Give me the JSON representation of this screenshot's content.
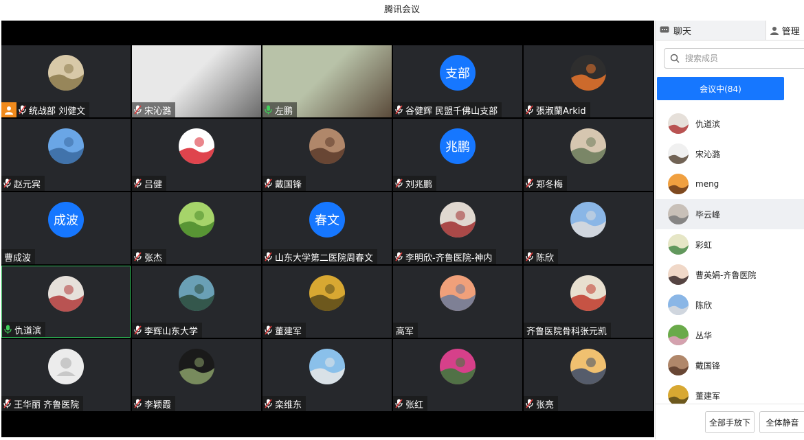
{
  "window": {
    "title": "腾讯会议"
  },
  "tiles": [
    {
      "name": "统战部 刘健文",
      "mic": "muted",
      "host": true,
      "avatar": {
        "kind": "photo",
        "colors": [
          "#d8c9a8",
          "#8c7a4c"
        ]
      }
    },
    {
      "name": "宋沁潞",
      "mic": "muted",
      "avatar": {
        "kind": "camera",
        "colors": [
          "#e8e8e8",
          "#6a6a6a"
        ]
      }
    },
    {
      "name": "左鹏",
      "mic": "on",
      "avatar": {
        "kind": "camera",
        "colors": [
          "#b8c2a8",
          "#5a4a3a"
        ]
      }
    },
    {
      "name": "谷健辉 民盟千佛山支部",
      "mic": "muted",
      "avatar": {
        "kind": "text",
        "text": "支部"
      }
    },
    {
      "name": "張淑蘭Arkid",
      "mic": "muted",
      "avatar": {
        "kind": "photo",
        "colors": [
          "#2e2e2e",
          "#e8742c"
        ]
      }
    },
    {
      "name": "赵元宾",
      "mic": "muted",
      "avatar": {
        "kind": "photo",
        "colors": [
          "#6aa6e6",
          "#3a6aa0"
        ]
      }
    },
    {
      "name": "吕健",
      "mic": "muted",
      "avatar": {
        "kind": "photo",
        "colors": [
          "#ffffff",
          "#d9232e"
        ]
      }
    },
    {
      "name": "戴国锋",
      "mic": "muted",
      "avatar": {
        "kind": "photo",
        "colors": [
          "#b0876a",
          "#5c3b2a"
        ]
      }
    },
    {
      "name": "刘兆鹏",
      "mic": "muted",
      "avatar": {
        "kind": "text",
        "text": "兆鹏"
      }
    },
    {
      "name": "郑冬梅",
      "mic": "muted",
      "avatar": {
        "kind": "photo",
        "colors": [
          "#d6c6b0",
          "#6a7a5a"
        ]
      }
    },
    {
      "name": "曹成波",
      "mic": "none",
      "avatar": {
        "kind": "text",
        "text": "成波"
      }
    },
    {
      "name": "张杰",
      "mic": "muted",
      "avatar": {
        "kind": "photo",
        "colors": [
          "#a6d46a",
          "#4a8a2a"
        ]
      }
    },
    {
      "name": "山东大学第二医院周春文",
      "mic": "muted",
      "avatar": {
        "kind": "text",
        "text": "春文"
      }
    },
    {
      "name": "李明欣-齐鲁医院-神内",
      "mic": "muted",
      "avatar": {
        "kind": "photo",
        "colors": [
          "#e0d8d0",
          "#a03030"
        ]
      }
    },
    {
      "name": "陈欣",
      "mic": "muted",
      "avatar": {
        "kind": "photo",
        "colors": [
          "#8ab6e6",
          "#dcdcdc"
        ]
      }
    },
    {
      "name": "仇道滨",
      "mic": "on",
      "active": true,
      "avatar": {
        "kind": "photo",
        "colors": [
          "#e6e0da",
          "#b03a3a"
        ]
      }
    },
    {
      "name": "李辉山东大学",
      "mic": "muted",
      "avatar": {
        "kind": "photo",
        "colors": [
          "#6aa0b6",
          "#2a4a3a"
        ]
      }
    },
    {
      "name": "董建军",
      "mic": "muted",
      "avatar": {
        "kind": "photo",
        "colors": [
          "#d8a832",
          "#5a4a1a"
        ]
      }
    },
    {
      "name": "高军",
      "mic": "none",
      "avatar": {
        "kind": "photo",
        "colors": [
          "#f0a07a",
          "#6a7a9a"
        ]
      }
    },
    {
      "name": "齐鲁医院骨科张元凯",
      "mic": "none",
      "avatar": {
        "kind": "photo",
        "colors": [
          "#e8e0d0",
          "#c0392b"
        ]
      }
    },
    {
      "name": "王华丽 齐鲁医院",
      "mic": "muted",
      "avatar": {
        "kind": "default"
      }
    },
    {
      "name": "李颖霞",
      "mic": "muted",
      "avatar": {
        "kind": "photo",
        "colors": [
          "#1a1a1a",
          "#8aa06a"
        ]
      }
    },
    {
      "name": "栾维东",
      "mic": "muted",
      "avatar": {
        "kind": "photo",
        "colors": [
          "#8ac0ea",
          "#e6e6e6"
        ]
      }
    },
    {
      "name": "张红",
      "mic": "muted",
      "avatar": {
        "kind": "photo",
        "colors": [
          "#d6408a",
          "#3a7a3a"
        ]
      }
    },
    {
      "name": "张亮",
      "mic": "muted",
      "avatar": {
        "kind": "photo",
        "colors": [
          "#f0c070",
          "#3a4a6a"
        ]
      }
    }
  ],
  "sidebar": {
    "tabs": {
      "chat": "聊天",
      "manage": "管理"
    },
    "search_placeholder": "搜索成员",
    "status_tab": "会议中(84)",
    "members": [
      {
        "name": "仇道滨",
        "colors": [
          "#e6e0da",
          "#b03a3a"
        ]
      },
      {
        "name": "宋沁潞",
        "colors": [
          "#f0f0f0",
          "#5a4a3a"
        ]
      },
      {
        "name": "meng",
        "colors": [
          "#f0a040",
          "#6a3a1a"
        ]
      },
      {
        "name": "毕云峰",
        "colors": [
          "#c8c0b8",
          "#7a7a7a"
        ],
        "highlight": true
      },
      {
        "name": "彩虹",
        "colors": [
          "#e6e6c6",
          "#4a8a4a"
        ]
      },
      {
        "name": "曹英娟-齐鲁医院",
        "colors": [
          "#f0d8c8",
          "#3a2a2a"
        ]
      },
      {
        "name": "陈欣",
        "colors": [
          "#8ab6e6",
          "#dcdcdc"
        ]
      },
      {
        "name": "丛华",
        "colors": [
          "#6aaa4a",
          "#e6a0c0"
        ]
      },
      {
        "name": "戴国锋",
        "colors": [
          "#b0876a",
          "#5c3b2a"
        ]
      },
      {
        "name": "董建军",
        "colors": [
          "#d8a832",
          "#5a4a1a"
        ]
      }
    ],
    "buttons": {
      "lower_all_hands": "全部手放下",
      "mute_all": "全体静音"
    }
  },
  "colors": {
    "accent": "#1677ff",
    "tile_bg": "#26282c",
    "active_border": "#2fbf5a",
    "host_badge": "#f08a1c"
  }
}
